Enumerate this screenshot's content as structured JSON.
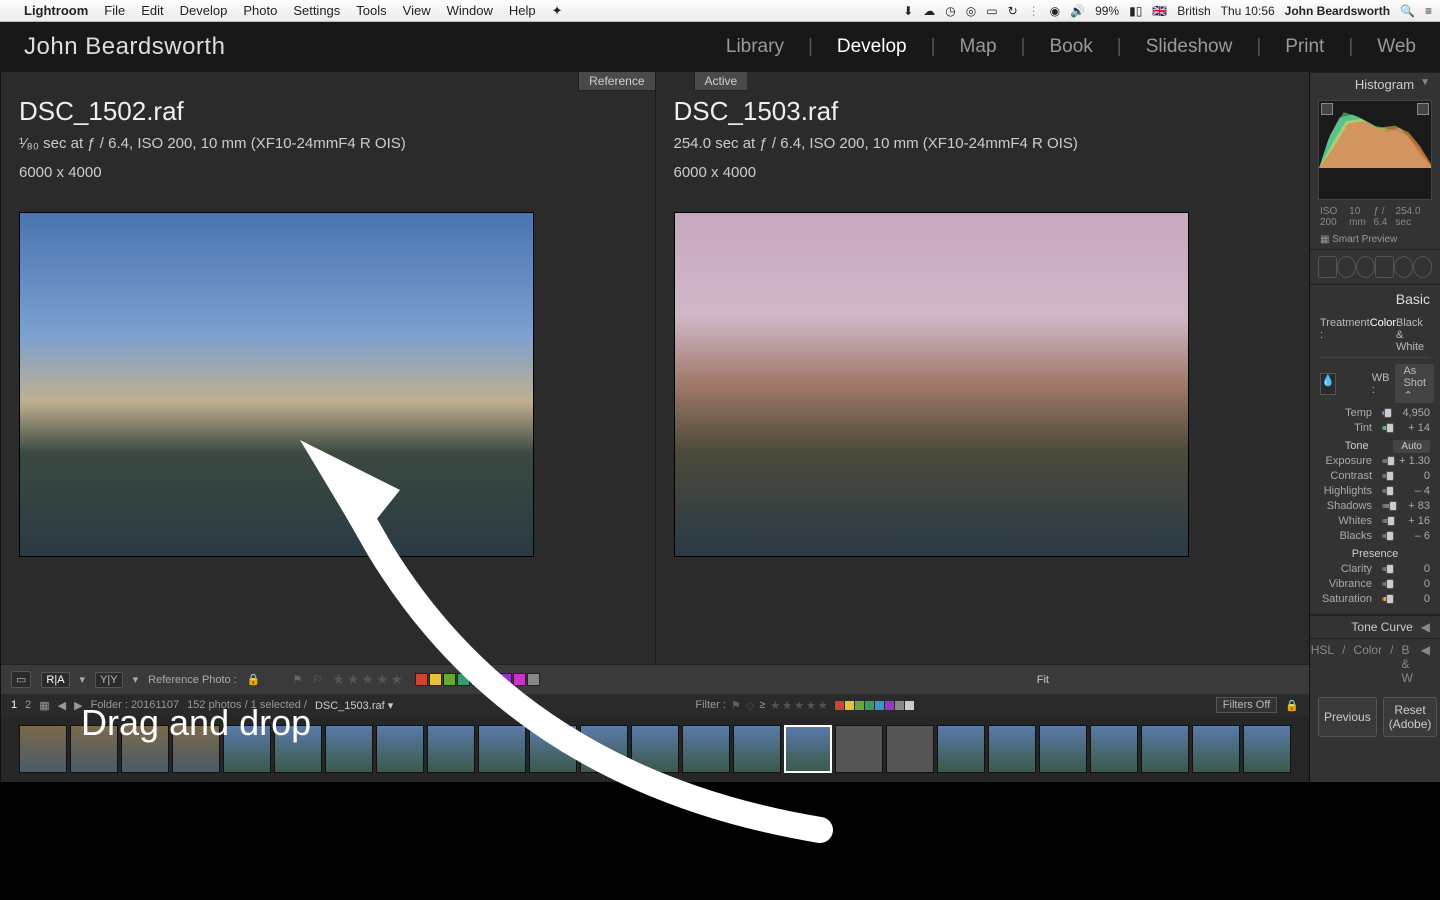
{
  "menubar": {
    "app": "Lightroom",
    "items": [
      "File",
      "Edit",
      "Develop",
      "Photo",
      "Settings",
      "Tools",
      "View",
      "Window",
      "Help"
    ],
    "battery": "99%",
    "lang": "British",
    "clock": "Thu 10:56",
    "user": "John Beardsworth"
  },
  "identity": "John Beardsworth",
  "modules": [
    "Library",
    "Develop",
    "Map",
    "Book",
    "Slideshow",
    "Print",
    "Web"
  ],
  "active_module": "Develop",
  "reference": {
    "tag": "Reference",
    "filename": "DSC_1502.raf",
    "meta1": "¹⁄₈₀ sec at ƒ / 6.4, ISO 200, 10 mm (XF10-24mmF4 R OIS)",
    "meta2": "6000 x 4000"
  },
  "active": {
    "tag": "Active",
    "filename": "DSC_1503.raf",
    "meta1": "254.0 sec at ƒ / 6.4, ISO 200, 10 mm (XF10-24mmF4 R OIS)",
    "meta2": "6000 x 4000"
  },
  "annotation": "Drag and drop",
  "toolbar": {
    "refphoto": "Reference Photo :",
    "fit": "Fit",
    "swatches": [
      "#c43",
      "#e6c23a",
      "#6a3",
      "#3a9b6a",
      "#39c",
      "#36d",
      "#93c",
      "#c3c",
      "#888"
    ]
  },
  "filter": {
    "pages": [
      "1",
      "2"
    ],
    "folder": "Folder : 20161107",
    "count": "152 photos / 1 selected /",
    "selfile": "DSC_1503.raf ▾",
    "label": "Filter :",
    "filtersoff": "Filters Off",
    "colors": [
      "#c43",
      "#e6c23a",
      "#6a3",
      "#3a9b6a",
      "#39c",
      "#93c",
      "#888",
      "#ccc"
    ]
  },
  "panel": {
    "histogram": {
      "title": "Histogram",
      "iso": "ISO 200",
      "focal": "10 mm",
      "ap": "ƒ / 6.4",
      "sh": "254.0 sec",
      "smart": "Smart Preview"
    },
    "basic": {
      "title": "Basic",
      "treatment": {
        "label": "Treatment :",
        "color": "Color",
        "bw": "Black & White"
      },
      "wb": {
        "label": "WB :",
        "preset": "As Shot"
      },
      "sliders": [
        {
          "lbl": "Temp",
          "val": "4,950",
          "cls": "temp",
          "pos": 30
        },
        {
          "lbl": "Tint",
          "val": "+ 14",
          "cls": "tint",
          "pos": 55
        }
      ],
      "tone": {
        "title": "Tone",
        "auto": "Auto",
        "sliders": [
          {
            "lbl": "Exposure",
            "val": "+ 1.30",
            "pos": 60
          },
          {
            "lbl": "Contrast",
            "val": "0",
            "pos": 50
          },
          {
            "lbl": "Highlights",
            "val": "– 4",
            "pos": 48
          },
          {
            "lbl": "Shadows",
            "val": "+ 83",
            "pos": 92
          },
          {
            "lbl": "Whites",
            "val": "+ 16",
            "pos": 58
          },
          {
            "lbl": "Blacks",
            "val": "– 6",
            "pos": 47
          }
        ]
      },
      "presence": {
        "title": "Presence",
        "sliders": [
          {
            "lbl": "Clarity",
            "val": "0",
            "pos": 50
          },
          {
            "lbl": "Vibrance",
            "val": "0",
            "pos": 50
          },
          {
            "lbl": "Saturation",
            "val": "0",
            "cls": "sat",
            "pos": 50
          }
        ]
      }
    },
    "tonecurve": "Tone Curve",
    "hsl": {
      "h": "HSL",
      "c": "Color",
      "b": "B & W"
    },
    "buttons": {
      "prev": "Previous",
      "reset": "Reset (Adobe)"
    }
  }
}
